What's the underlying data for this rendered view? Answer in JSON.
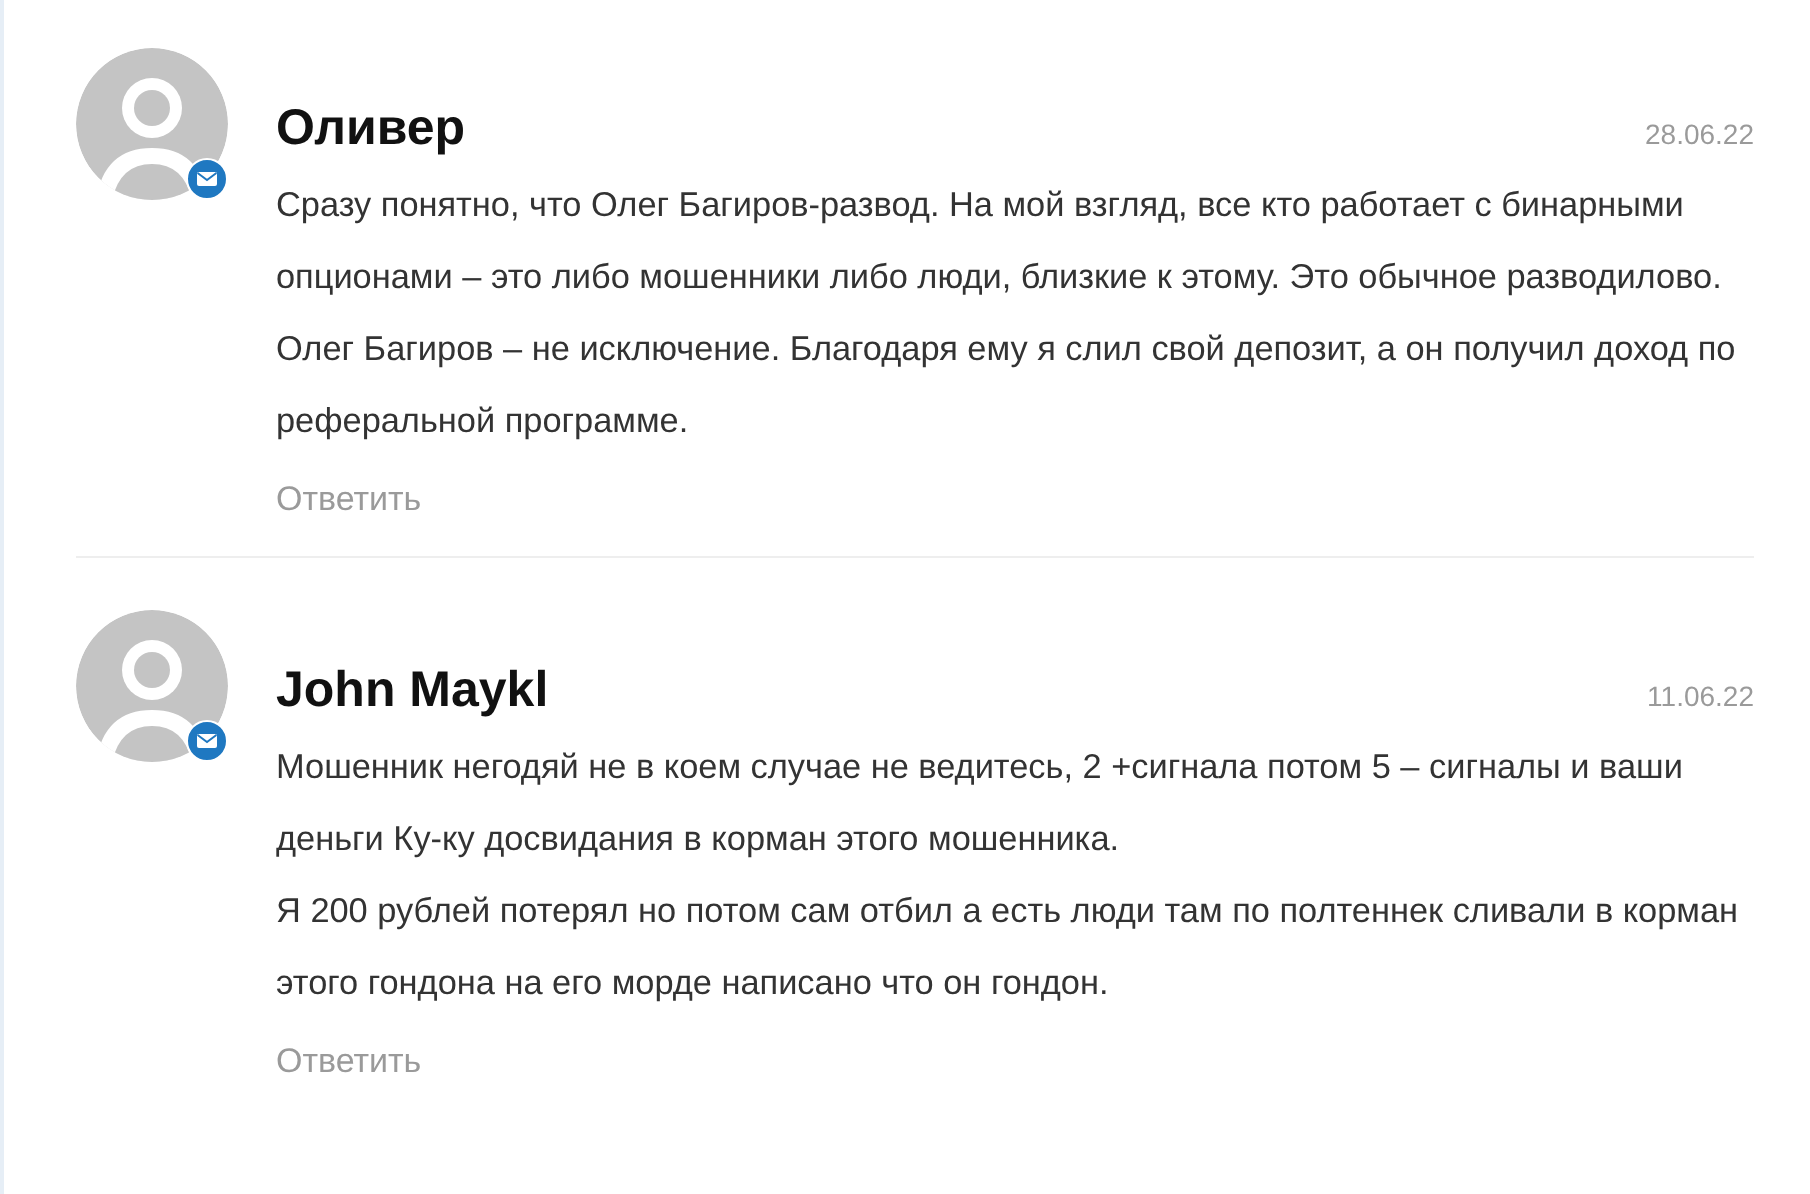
{
  "comments": [
    {
      "author": "Оливер",
      "date": "28.06.22",
      "paragraphs": [
        "Сразу понятно, что Олег Багиров-развод. На мой взгляд, все кто работает с бинарными опционами – это либо мошенники либо люди, близкие к этому. Это обычное разводилово. Олег Багиров – не исключение. Благодаря ему я слил свой депозит, а он получил доход по реферальной программе."
      ],
      "reply": "Ответить"
    },
    {
      "author": "John Maykl",
      "date": "11.06.22",
      "paragraphs": [
        "Мошенник негодяй не в коем случае не ведитесь, 2 +сигнала потом 5 – сигналы и ваши деньги Ку-ку досвидания в корман этого мошенника.",
        "Я 200 рублей потерял но потом сам отбил а есть люди там по полтеннек сливали в корман этого гондона на его морде написано что он гондон."
      ],
      "reply": "Ответить"
    }
  ]
}
